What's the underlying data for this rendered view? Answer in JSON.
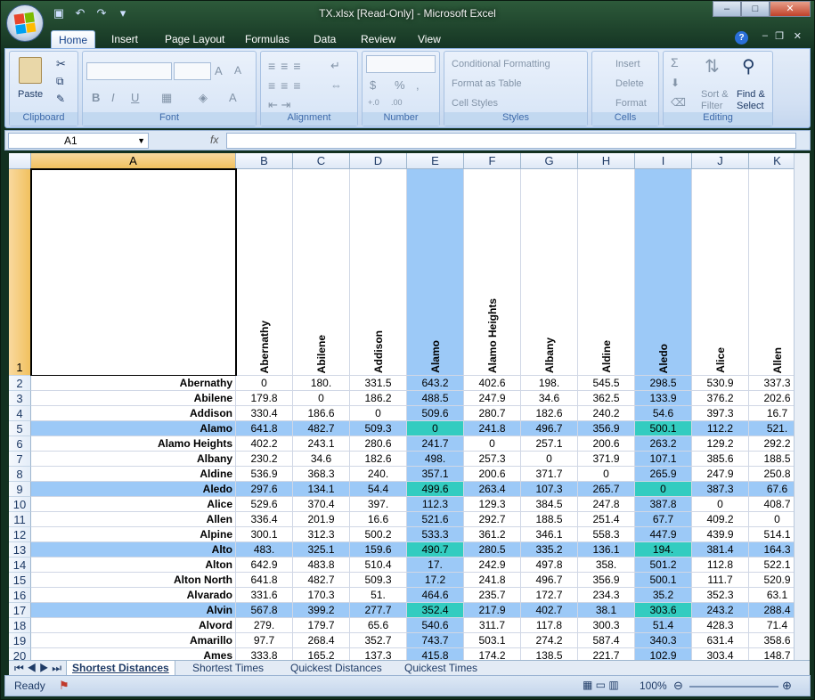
{
  "window": {
    "title": "TX.xlsx  [Read-Only] - Microsoft Excel",
    "controls": [
      "–",
      "□",
      "✕"
    ]
  },
  "ribbon_tabs": [
    "Home",
    "Insert",
    "Page Layout",
    "Formulas",
    "Data",
    "Review",
    "View"
  ],
  "ribbon": {
    "clipboard": {
      "label": "Clipboard",
      "paste": "Paste"
    },
    "font": {
      "label": "Font"
    },
    "alignment": {
      "label": "Alignment"
    },
    "number": {
      "label": "Number"
    },
    "styles": {
      "label": "Styles",
      "conditional": "Conditional Formatting",
      "format_table": "Format as Table",
      "cell_styles": "Cell Styles"
    },
    "cells": {
      "label": "Cells",
      "insert": "Insert",
      "delete": "Delete",
      "format": "Format"
    },
    "editing": {
      "label": "Editing",
      "sort": "Sort &",
      "filter": "Filter",
      "find": "Find &",
      "select": "Select"
    }
  },
  "formula_bar": {
    "name_box": "A1",
    "fx": "fx",
    "value": ""
  },
  "columns": [
    "A",
    "B",
    "C",
    "D",
    "E",
    "F",
    "G",
    "H",
    "I",
    "J",
    "K"
  ],
  "header_names": [
    "Abernathy",
    "Abilene",
    "Addison",
    "Alamo",
    "Alamo Heights",
    "Albany",
    "Aldine",
    "Aledo",
    "Alice",
    "Allen"
  ],
  "rows": [
    {
      "num": "1",
      "name": "",
      "values": []
    },
    {
      "num": "2",
      "name": "Abernathy",
      "values": [
        "0",
        "180.",
        "331.5",
        "643.2",
        "402.6",
        "198.",
        "545.5",
        "298.5",
        "530.9",
        "337.3"
      ]
    },
    {
      "num": "3",
      "name": "Abilene",
      "values": [
        "179.8",
        "0",
        "186.2",
        "488.5",
        "247.9",
        "34.6",
        "362.5",
        "133.9",
        "376.2",
        "202.6"
      ]
    },
    {
      "num": "4",
      "name": "Addison",
      "values": [
        "330.4",
        "186.6",
        "0",
        "509.6",
        "280.7",
        "182.6",
        "240.2",
        "54.6",
        "397.3",
        "16.7"
      ]
    },
    {
      "num": "5",
      "name": "Alamo",
      "values": [
        "641.8",
        "482.7",
        "509.3",
        "0",
        "241.8",
        "496.7",
        "356.9",
        "500.1",
        "112.2",
        "521."
      ]
    },
    {
      "num": "6",
      "name": "Alamo Heights",
      "values": [
        "402.2",
        "243.1",
        "280.6",
        "241.7",
        "0",
        "257.1",
        "200.6",
        "263.2",
        "129.2",
        "292.2"
      ]
    },
    {
      "num": "7",
      "name": "Albany",
      "values": [
        "230.2",
        "34.6",
        "182.6",
        "498.",
        "257.3",
        "0",
        "371.9",
        "107.1",
        "385.6",
        "188.5"
      ]
    },
    {
      "num": "8",
      "name": "Aldine",
      "values": [
        "536.9",
        "368.3",
        "240.",
        "357.1",
        "200.6",
        "371.7",
        "0",
        "265.9",
        "247.9",
        "250.8"
      ]
    },
    {
      "num": "9",
      "name": "Aledo",
      "values": [
        "297.6",
        "134.1",
        "54.4",
        "499.6",
        "263.4",
        "107.3",
        "265.7",
        "0",
        "387.3",
        "67.6"
      ]
    },
    {
      "num": "10",
      "name": "Alice",
      "values": [
        "529.6",
        "370.4",
        "397.",
        "112.3",
        "129.3",
        "384.5",
        "247.8",
        "387.8",
        "0",
        "408.7"
      ]
    },
    {
      "num": "11",
      "name": "Allen",
      "values": [
        "336.4",
        "201.9",
        "16.6",
        "521.6",
        "292.7",
        "188.5",
        "251.4",
        "67.7",
        "409.2",
        "0"
      ]
    },
    {
      "num": "12",
      "name": "Alpine",
      "values": [
        "300.1",
        "312.3",
        "500.2",
        "533.3",
        "361.2",
        "346.1",
        "558.3",
        "447.9",
        "439.9",
        "514.1"
      ]
    },
    {
      "num": "13",
      "name": "Alto",
      "values": [
        "483.",
        "325.1",
        "159.6",
        "490.7",
        "280.5",
        "335.2",
        "136.1",
        "194.",
        "381.4",
        "164.3"
      ]
    },
    {
      "num": "14",
      "name": "Alton",
      "values": [
        "642.9",
        "483.8",
        "510.4",
        "17.",
        "242.9",
        "497.8",
        "358.",
        "501.2",
        "112.8",
        "522.1"
      ]
    },
    {
      "num": "15",
      "name": "Alton North",
      "values": [
        "641.8",
        "482.7",
        "509.3",
        "17.2",
        "241.8",
        "496.7",
        "356.9",
        "500.1",
        "111.7",
        "520.9"
      ]
    },
    {
      "num": "16",
      "name": "Alvarado",
      "values": [
        "331.6",
        "170.3",
        "51.",
        "464.6",
        "235.7",
        "172.7",
        "234.3",
        "35.2",
        "352.3",
        "63.1"
      ]
    },
    {
      "num": "17",
      "name": "Alvin",
      "values": [
        "567.8",
        "399.2",
        "277.7",
        "352.4",
        "217.9",
        "402.7",
        "38.1",
        "303.6",
        "243.2",
        "288.4"
      ]
    },
    {
      "num": "18",
      "name": "Alvord",
      "values": [
        "279.",
        "179.7",
        "65.6",
        "540.6",
        "311.7",
        "117.8",
        "300.3",
        "51.4",
        "428.3",
        "71.4"
      ]
    },
    {
      "num": "19",
      "name": "Amarillo",
      "values": [
        "97.7",
        "268.4",
        "352.7",
        "743.7",
        "503.1",
        "274.2",
        "587.4",
        "340.3",
        "631.4",
        "358.6"
      ]
    },
    {
      "num": "20",
      "name": "Ames",
      "values": [
        "333.8",
        "165.2",
        "137.3",
        "415.8",
        "174.2",
        "138.5",
        "221.7",
        "102.9",
        "303.4",
        "148.7"
      ]
    }
  ],
  "highlight": {
    "cols": [
      "E",
      "I"
    ],
    "rows": [
      "5",
      "9",
      "13",
      "17"
    ],
    "col_color": "#9cc9f7",
    "cross_color": "#33ccc0"
  },
  "sheet_tabs": [
    "Shortest Distances",
    "Shortest Times",
    "Quickest Distances",
    "Quickest Times"
  ],
  "status": {
    "text": "Ready",
    "zoom": "100%"
  }
}
